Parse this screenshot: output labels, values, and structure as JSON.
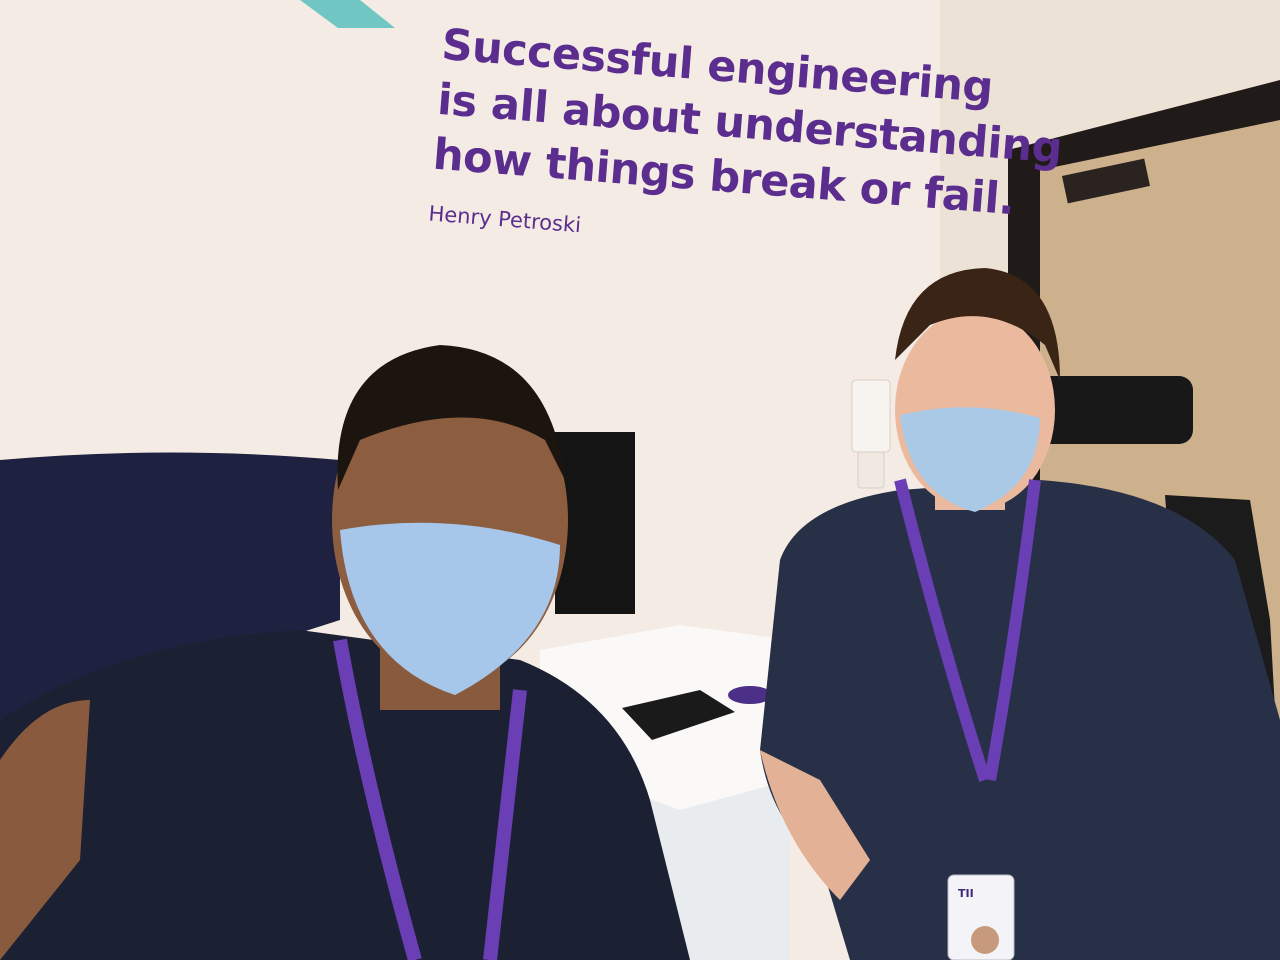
{
  "wall_quote": {
    "lines": [
      "Successful engineering",
      "is all about understanding",
      "how things break or fail."
    ],
    "author": "Henry Petroski"
  },
  "badge": {
    "logo_text": "TII"
  },
  "colors": {
    "wall": "#f3ebe3",
    "quote_text": "#5b2d8e",
    "lanyard": "#6a3fb5",
    "shirt": "#1d2338",
    "mask": "#a9c9e6",
    "door": "#c9ab86"
  }
}
